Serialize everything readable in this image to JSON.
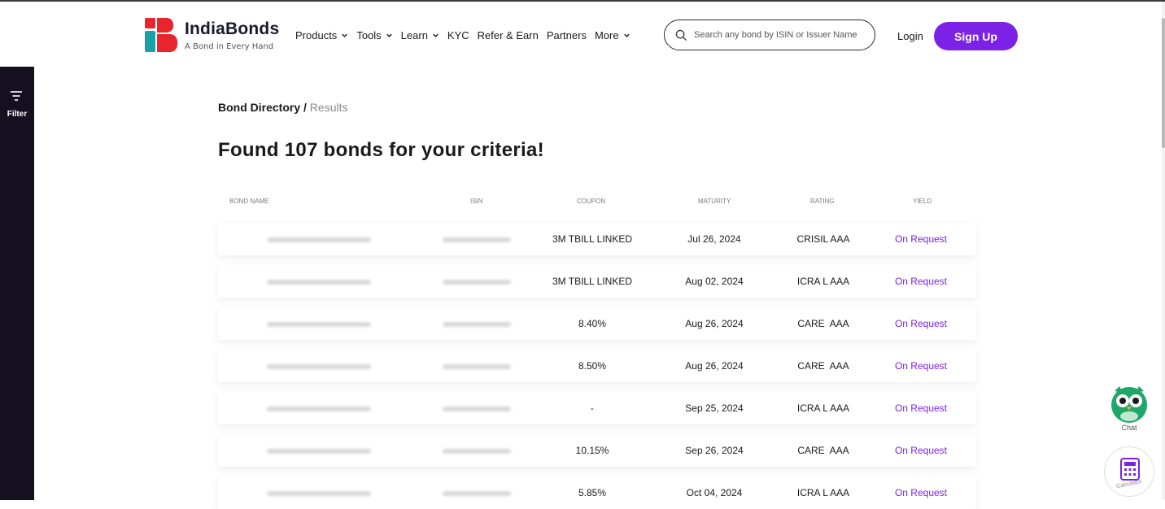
{
  "brand": {
    "name": "IndiaBonds",
    "tagline": "A Bond in Every Hand"
  },
  "nav": [
    {
      "label": "Products",
      "dropdown": true
    },
    {
      "label": "Tools",
      "dropdown": true
    },
    {
      "label": "Learn",
      "dropdown": true
    },
    {
      "label": "KYC",
      "dropdown": false
    },
    {
      "label": "Refer & Earn",
      "dropdown": false
    },
    {
      "label": "Partners",
      "dropdown": false
    },
    {
      "label": "More",
      "dropdown": true
    }
  ],
  "search": {
    "placeholder": "Search any bond by ISIN or Issuer Name"
  },
  "auth": {
    "login": "Login",
    "signup": "Sign Up"
  },
  "filter": {
    "label": "Filter"
  },
  "breadcrumb": {
    "root": "Bond Directory",
    "separator": "/",
    "current": "Results"
  },
  "page_title": "Found 107 bonds for your criteria!",
  "table": {
    "columns": [
      "BOND NAME",
      "ISIN",
      "COUPON",
      "MATURITY",
      "RATING",
      "YIELD"
    ],
    "rows": [
      {
        "coupon": "3M TBILL LINKED",
        "maturity": "Jul 26, 2024",
        "rating": "CRISIL AAA",
        "yield": "On Request"
      },
      {
        "coupon": "3M TBILL LINKED",
        "maturity": "Aug 02, 2024",
        "rating": "ICRA L AAA",
        "yield": "On Request"
      },
      {
        "coupon": "8.40%",
        "maturity": "Aug 26, 2024",
        "rating": "CARE  AAA",
        "yield": "On Request"
      },
      {
        "coupon": "8.50%",
        "maturity": "Aug 26, 2024",
        "rating": "CARE  AAA",
        "yield": "On Request"
      },
      {
        "coupon": "-",
        "maturity": "Sep 25, 2024",
        "rating": "ICRA L AAA",
        "yield": "On Request"
      },
      {
        "coupon": "10.15%",
        "maturity": "Sep 26, 2024",
        "rating": "CARE  AAA",
        "yield": "On Request"
      },
      {
        "coupon": "5.85%",
        "maturity": "Oct 04, 2024",
        "rating": "ICRA L AAA",
        "yield": "On Request"
      }
    ]
  },
  "widgets": {
    "chat": "Chat",
    "calculator": "Calculator"
  },
  "colors": {
    "accent": "#7b22e6",
    "logo_red": "#e8242c",
    "logo_teal": "#1aa0a8",
    "sidebar": "#14101f"
  }
}
